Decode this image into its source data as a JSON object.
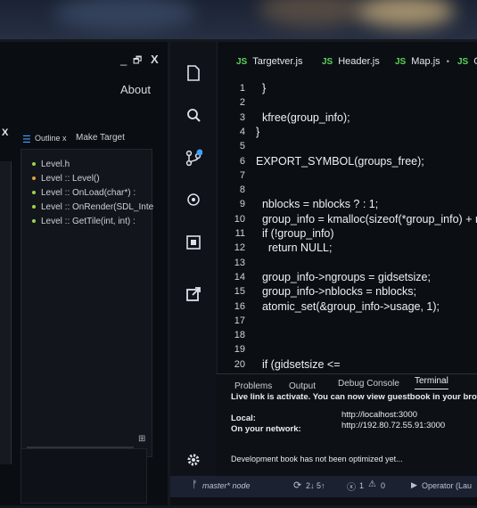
{
  "left_window": {
    "controls": {
      "minimize": "_",
      "maximize": "🗗",
      "close": "X"
    },
    "menu_about": "About",
    "panel_close": "X",
    "outline_tab": "Outline x",
    "make_target_tab": "Make Target",
    "outline_items": [
      "Level.h",
      "Level :: Level()",
      "Level :: OnLoad(char*)  :",
      "Level :: OnRender(SDL_Inte",
      "Level :: GetTile(int, int)  :"
    ]
  },
  "editor": {
    "tabs": [
      {
        "icon": "JS",
        "label": "Targetver.js"
      },
      {
        "icon": "JS",
        "label": "Header.js"
      },
      {
        "icon": "JS",
        "label": "Map.js",
        "marker": "•"
      },
      {
        "icon": "JS",
        "label": "G"
      }
    ],
    "lines": [
      {
        "n": "1",
        "code": "  }"
      },
      {
        "n": "2",
        "code": ""
      },
      {
        "n": "3",
        "code": "  kfree(group_info);"
      },
      {
        "n": "4",
        "code": "}"
      },
      {
        "n": "5",
        "code": ""
      },
      {
        "n": "6",
        "code": "EXPORT_SYMBOL(groups_free);"
      },
      {
        "n": "7",
        "code": ""
      },
      {
        "n": "8",
        "code": ""
      },
      {
        "n": "9",
        "code": "  nblocks = nblocks ? : 1;"
      },
      {
        "n": "10",
        "code": "  group_info = kmalloc(sizeof(*group_info) + n"
      },
      {
        "n": "11",
        "code": "  if (!group_info)"
      },
      {
        "n": "12",
        "code": "    return NULL;"
      },
      {
        "n": "13",
        "code": ""
      },
      {
        "n": "14",
        "code": "  group_info->ngroups = gidsetsize;"
      },
      {
        "n": "15",
        "code": "  group_info->nblocks = nblocks;"
      },
      {
        "n": "16",
        "code": "  atomic_set(&group_info->usage, 1);"
      },
      {
        "n": "17",
        "code": ""
      },
      {
        "n": "18",
        "code": ""
      },
      {
        "n": "19",
        "code": ""
      },
      {
        "n": "20",
        "code": "  if (gidsetsize <="
      }
    ]
  },
  "panel": {
    "tabs": [
      "Problems",
      "Output",
      "Debug Console",
      "Terminal"
    ],
    "active_tab": "Terminal",
    "live_link": "Live link is activate. You can now view guestbook in your brow",
    "local_label": "Local:",
    "local_url": "http://localhost:3000",
    "network_label": "On your network:",
    "network_url": "http://192.80.72.55.91:3000",
    "dev_message": "Development book has not been optimized yet..."
  },
  "status": {
    "branch": "master* node",
    "sync": "2↓  5↑",
    "errors": "1",
    "warnings": "0",
    "operator": "Operator (Lau"
  },
  "colors": {
    "js_badge": "#5dd35a",
    "outline_dot": "#9fd24c",
    "accent_badge": "#3fa0ff"
  }
}
